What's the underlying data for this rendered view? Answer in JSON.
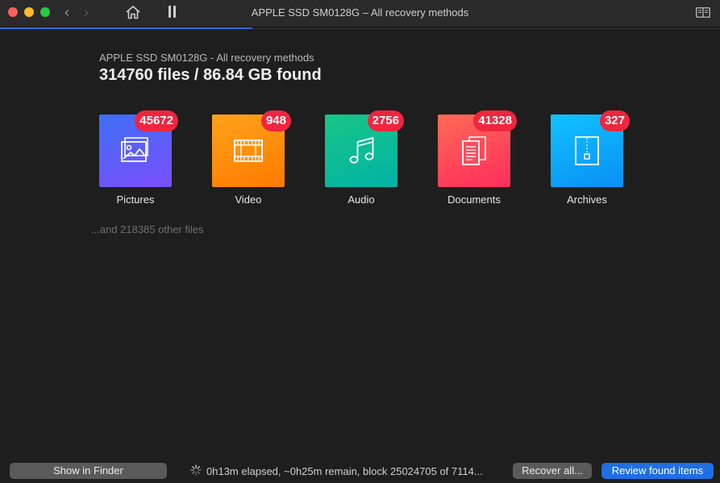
{
  "window": {
    "title": "APPLE SSD SM0128G – All recovery methods",
    "scan_progress": 0.35
  },
  "icons": {
    "back": "chevron-left-icon",
    "forward": "chevron-right-icon",
    "home": "home-icon",
    "pause": "pause-icon",
    "sidebar": "book-icon",
    "spinner": "spinner-icon"
  },
  "summary": {
    "subtitle": "APPLE SSD SM0128G - All recovery methods",
    "headline": "314760 files / 86.84 GB found",
    "other_files": "...and 218385 other files"
  },
  "categories": [
    {
      "label": "Pictures",
      "count": "45672",
      "icon": "picture-icon"
    },
    {
      "label": "Video",
      "count": "948",
      "icon": "film-icon"
    },
    {
      "label": "Audio",
      "count": "2756",
      "icon": "music-note-icon"
    },
    {
      "label": "Documents",
      "count": "41328",
      "icon": "documents-icon"
    },
    {
      "label": "Archives",
      "count": "327",
      "icon": "archive-icon"
    }
  ],
  "footer": {
    "show_in_finder": "Show in Finder",
    "status": "0h13m elapsed, ~0h25m remain, block 25024705 of 7114...",
    "recover_all": "Recover all...",
    "review": "Review found items"
  },
  "colors": {
    "accent": "#1f6fe5",
    "badge": "#f0253e",
    "pictures": "#5a5ef9",
    "video": "#ff8f0d",
    "audio": "#0dbc96",
    "documents": "#ff4558",
    "archives": "#0ea9fa"
  }
}
